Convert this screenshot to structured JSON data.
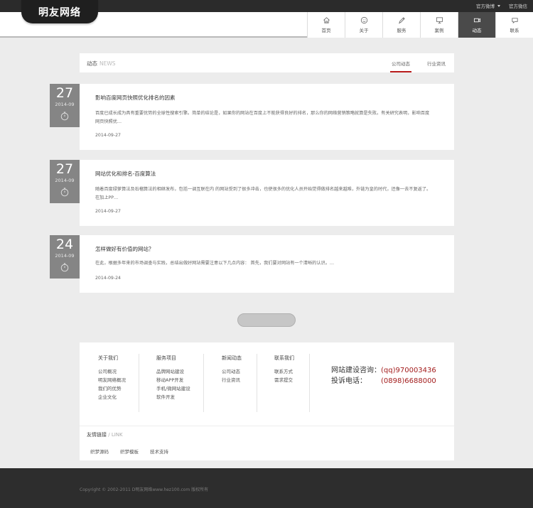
{
  "top_links": [
    "官方微博",
    "官方微信"
  ],
  "logo": "明友网络",
  "nav": [
    {
      "label": "首页",
      "icon": "home-icon"
    },
    {
      "label": "关于",
      "icon": "smile-icon"
    },
    {
      "label": "服务",
      "icon": "pen-icon"
    },
    {
      "label": "案例",
      "icon": "monitor-icon"
    },
    {
      "label": "动态",
      "icon": "video-icon",
      "active": true
    },
    {
      "label": "联系",
      "icon": "chat-icon"
    }
  ],
  "section": {
    "title": "动态",
    "title_en": "NEWS",
    "tabs": [
      "公司动态",
      "行业资讯"
    ],
    "active_tab": 0
  },
  "news": [
    {
      "day": "27",
      "ym": "2014-09",
      "title": "影响百度网页快照优化排名的因素",
      "line1": "百度已成长成为具有重要优势的全球性搜索引擎。简单的结论是，如果你的网站在百度上不能获得良好的排名，那么你的网络营销策略就算是失败。有关研究表明，影响百度",
      "line2": "网页快照优…",
      "date": "2014-09-27"
    },
    {
      "day": "27",
      "ym": "2014-09",
      "title": "网站优化和排名-百度算法",
      "line1": "随着百度绿萝算法及石榴算法的相继发布，包括一调互联在内 的网站受到了很多冲击，也使很多的优化人员开始觉得做排名越来越难，外链为皇的时代，还像一去不复返了。",
      "line2": "在加上PP…",
      "date": "2014-09-27"
    },
    {
      "day": "24",
      "ym": "2014-09",
      "title": "怎样做好有价值的网站？",
      "line1": "在此，根据多年来的市场调查与实践，总结出做好网站需要注意以下几点内容：     首先，我们要对网站有一个清晰的认识。…",
      "line2": "",
      "date": "2014-09-24"
    }
  ],
  "footer": {
    "columns": [
      {
        "heading": "关于我们",
        "links": [
          "公司概况",
          "明友网络概况",
          "我们的优势",
          "企业文化"
        ]
      },
      {
        "heading": "服务项目",
        "links": [
          "品牌网站建设",
          "移动APP开发",
          "手机/微网站建设",
          "软件开发"
        ]
      },
      {
        "heading": "新闻动态",
        "links": [
          "公司动态",
          "行业资讯"
        ]
      },
      {
        "heading": "联系我们",
        "links": [
          "联系方式",
          "需求提交"
        ]
      }
    ],
    "contact": {
      "label1": "网站建设咨询：",
      "value1": "(qq)970003436",
      "label2": "投诉电话：",
      "value2": "(0898)6688000"
    },
    "friend_links_title": "友情链接",
    "friend_links_title_en": "LINK",
    "friend_links": [
      "织梦源码",
      "织梦模板",
      "技术支持"
    ]
  },
  "copyright": "Copyright © 2002-2011 D明友网络www.hez100.com 版权所有"
}
